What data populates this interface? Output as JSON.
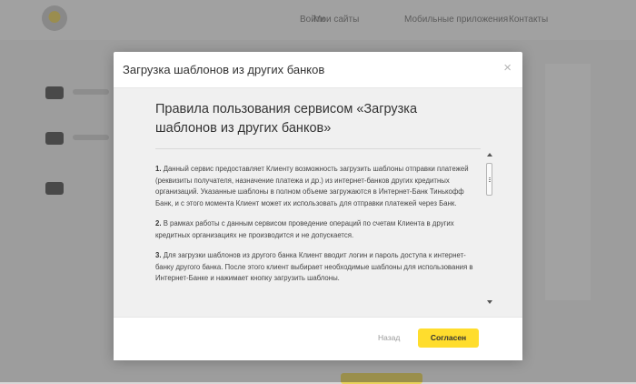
{
  "background": {
    "nav": [
      "Войти",
      "Интернет-банк",
      "Контакты",
      "Мобильные приложения",
      "Мои сайты"
    ]
  },
  "modal": {
    "title": "Загрузка шаблонов из других банков",
    "close_icon": "×",
    "heading": "Правила пользования сервисом «Загрузка шаблонов из других банков»",
    "paragraphs": [
      {
        "num": "1.",
        "text": "Данный сервис предоставляет Клиенту возможность загрузить шаблоны отправки платежей (реквизиты получателя, назначение платежа и др.) из интернет-банков других кредитных организаций. Указанные шаблоны в полном объеме загружаются в Интернет-Банк Тинькофф Банк, и с этого момента Клиент может их использовать для отправки платежей через Банк."
      },
      {
        "num": "2.",
        "text": "В рамках работы с данным сервисом проведение операций по счетам Клиента в других кредитных организациях не производится и не допускается."
      },
      {
        "num": "3.",
        "text": "Для загрузки шаблонов из другого банка Клиент вводит логин и пароль доступа к интернет-банку другого банка. После этого клиент выбирает необходимые шаблоны для использования в Интернет-Банке и нажимает кнопку загрузить шаблоны."
      }
    ],
    "back_label": "Назад",
    "agree_label": "Согласен"
  },
  "colors": {
    "accent_yellow": "#ffdd2d",
    "overlay": "rgba(60,60,60,0.45)",
    "green": "#3fb67b",
    "orange": "#f08a35"
  }
}
